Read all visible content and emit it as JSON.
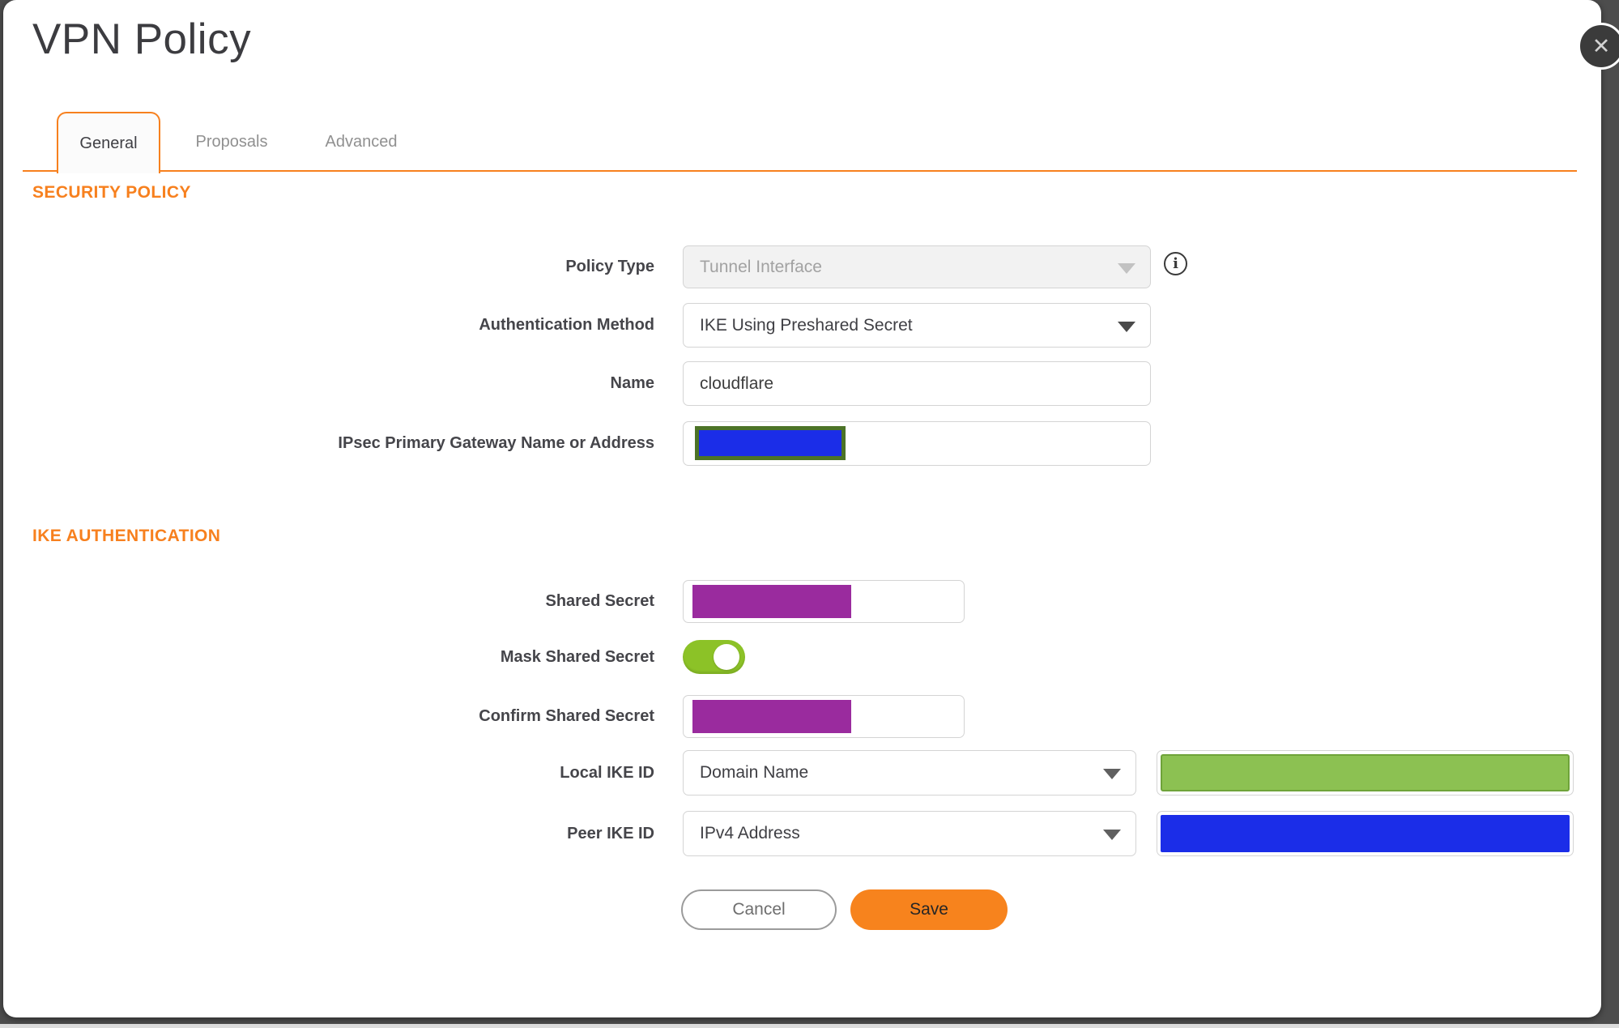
{
  "title": "VPN Policy",
  "icons": {
    "close": "✕",
    "info": "i"
  },
  "tabs": [
    {
      "label": "General",
      "active": true
    },
    {
      "label": "Proposals",
      "active": false
    },
    {
      "label": "Advanced",
      "active": false
    }
  ],
  "security_policy": {
    "heading": "SECURITY POLICY",
    "policy_type": {
      "label": "Policy Type",
      "value": "Tunnel Interface",
      "disabled": true
    },
    "authentication_method": {
      "label": "Authentication Method",
      "value": "IKE Using Preshared Secret"
    },
    "name": {
      "label": "Name",
      "value": "cloudflare"
    },
    "gateway": {
      "label": "IPsec Primary Gateway Name or Address",
      "value_redacted": true,
      "redaction_color": "blue"
    }
  },
  "ike_authentication": {
    "heading": "IKE AUTHENTICATION",
    "shared_secret": {
      "label": "Shared Secret",
      "value_redacted": true,
      "redaction_color": "purple"
    },
    "mask_shared_secret": {
      "label": "Mask Shared Secret",
      "enabled": true
    },
    "confirm_shared_secret": {
      "label": "Confirm Shared Secret",
      "value_redacted": true,
      "redaction_color": "purple"
    },
    "local_ike_id": {
      "label": "Local IKE ID",
      "type_value": "Domain Name",
      "value_redacted": true,
      "redaction_color": "green"
    },
    "peer_ike_id": {
      "label": "Peer IKE ID",
      "type_value": "IPv4 Address",
      "value_redacted": true,
      "redaction_color": "blue"
    }
  },
  "buttons": {
    "cancel": "Cancel",
    "save": "Save"
  },
  "colors": {
    "accent_orange": "#F7801E",
    "save_orange": "#F7831D",
    "redact_blue": "#1B2DE8",
    "redact_purple": "#9A2B9E",
    "redact_green": "#8CC152",
    "redact_green_border": "#6FA33A",
    "gateway_olive_border": "#4C7327",
    "toggle_green": "#8CC227"
  }
}
